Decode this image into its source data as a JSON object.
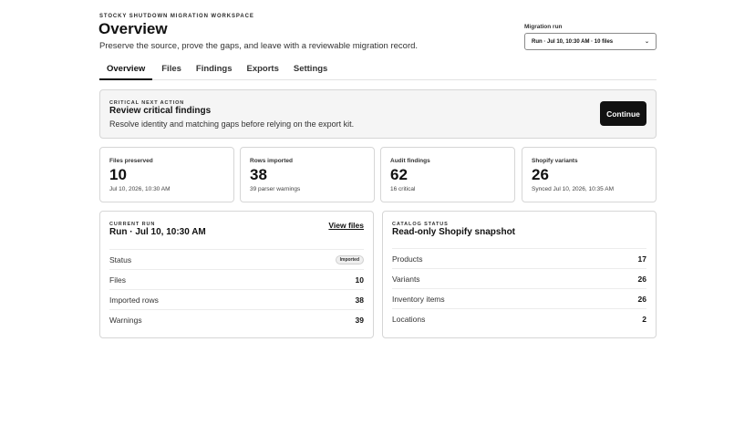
{
  "header": {
    "eyebrow": "STOCKY SHUTDOWN MIGRATION WORKSPACE",
    "title": "Overview",
    "subtitle": "Preserve the source, prove the gaps, and leave with a reviewable migration record."
  },
  "run_selector": {
    "label": "Migration run",
    "value": "Run · Jul 10, 10:30 AM · 10 files"
  },
  "tabs": [
    {
      "label": "Overview",
      "active": true
    },
    {
      "label": "Files",
      "active": false
    },
    {
      "label": "Findings",
      "active": false
    },
    {
      "label": "Exports",
      "active": false
    },
    {
      "label": "Settings",
      "active": false
    }
  ],
  "banner": {
    "eyebrow": "CRITICAL NEXT ACTION",
    "heading": "Review critical findings",
    "description": "Resolve identity and matching gaps before relying on the export kit.",
    "button": "Continue"
  },
  "stats": [
    {
      "label": "Files preserved",
      "value": "10",
      "sub": "Jul 10, 2026, 10:30 AM"
    },
    {
      "label": "Rows imported",
      "value": "38",
      "sub": "39 parser warnings"
    },
    {
      "label": "Audit findings",
      "value": "62",
      "sub": "16 critical"
    },
    {
      "label": "Shopify variants",
      "value": "26",
      "sub": "Synced Jul 10, 2026, 10:35 AM"
    }
  ],
  "current_run": {
    "eyebrow": "CURRENT RUN",
    "heading": "Run · Jul 10, 10:30 AM",
    "link": "View files",
    "rows": [
      {
        "label": "Status",
        "value": "Imported"
      },
      {
        "label": "Files",
        "value": "10"
      },
      {
        "label": "Imported rows",
        "value": "38"
      },
      {
        "label": "Warnings",
        "value": "39"
      }
    ]
  },
  "catalog_status": {
    "eyebrow": "CATALOG STATUS",
    "heading": "Read-only Shopify snapshot",
    "rows": [
      {
        "label": "Products",
        "value": "17"
      },
      {
        "label": "Variants",
        "value": "26"
      },
      {
        "label": "Inventory items",
        "value": "26"
      },
      {
        "label": "Locations",
        "value": "2"
      }
    ]
  }
}
